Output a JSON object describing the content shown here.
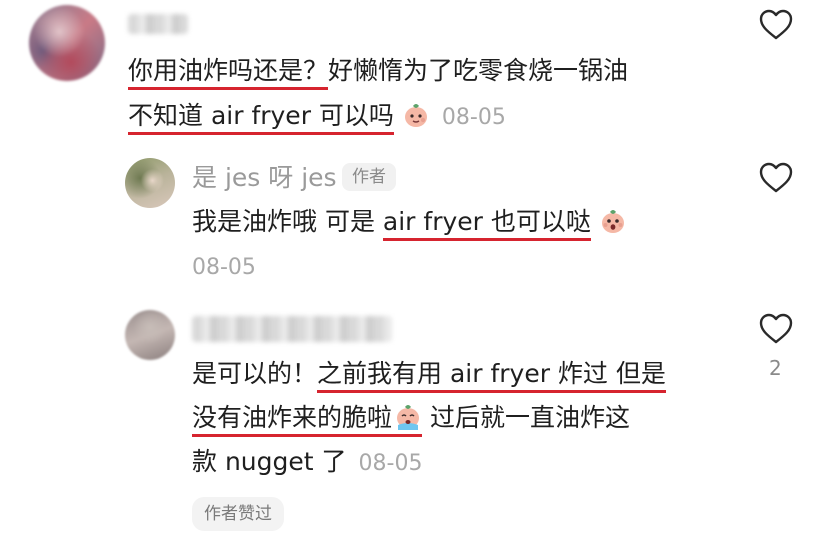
{
  "comments": [
    {
      "line1_a": "你用油炸吗还是？",
      "line1_b": "好懒惰为了吃零食烧一锅油",
      "line2_a": "不知道 air fryer 可以吗",
      "date": "08-05",
      "emoji": "peach-emoji"
    },
    {
      "username": "是 jes 呀 jes",
      "badge": "作者",
      "line1_a": "我是油炸哦  可是 ",
      "line1_b": "air fryer 也可以哒",
      "date": "08-05",
      "emoji": "peach-surprised-emoji"
    },
    {
      "line1_a": "是可以的！",
      "line1_b": "之前我有用 air fryer 炸过 但是",
      "line2_a": "没有油炸来的脆啦",
      "line2_b": " 过后就一直油炸这",
      "line3_a": "款 nugget 了",
      "date": "08-05",
      "like_count": "2",
      "liked_badge": "作者赞过",
      "emoji": "peach-crying-emoji"
    }
  ],
  "colors": {
    "underline": "#d6242f",
    "text": "#1f1f1f",
    "muted": "#a8a8a8"
  }
}
